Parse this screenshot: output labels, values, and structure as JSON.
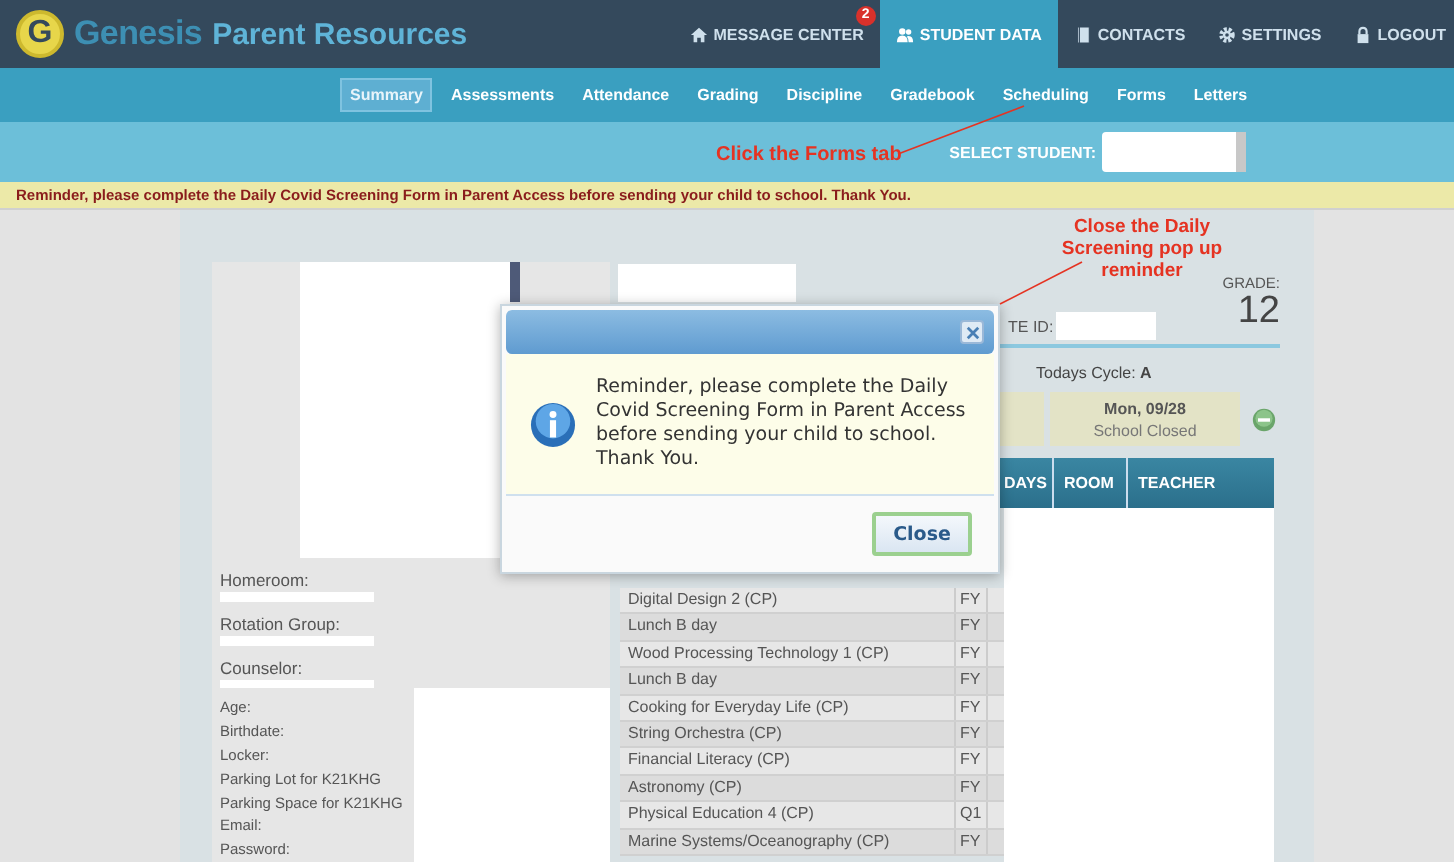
{
  "header": {
    "logo_letter": "G",
    "brand": "Genesis",
    "subtitle": "Parent Resources",
    "nav": [
      {
        "label": "MESSAGE CENTER",
        "badge": "2",
        "selected": false
      },
      {
        "label": "STUDENT DATA",
        "selected": true
      },
      {
        "label": "CONTACTS",
        "selected": false
      },
      {
        "label": "SETTINGS",
        "selected": false
      },
      {
        "label": "LOGOUT",
        "selected": false
      }
    ]
  },
  "tabs": [
    {
      "label": "Summary",
      "selected": true
    },
    {
      "label": "Assessments",
      "selected": false
    },
    {
      "label": "Attendance",
      "selected": false
    },
    {
      "label": "Grading",
      "selected": false
    },
    {
      "label": "Discipline",
      "selected": false
    },
    {
      "label": "Gradebook",
      "selected": false
    },
    {
      "label": "Scheduling",
      "selected": false
    },
    {
      "label": "Forms",
      "selected": false
    },
    {
      "label": "Letters",
      "selected": false
    }
  ],
  "student_select": {
    "label": "SELECT STUDENT:"
  },
  "reminder_banner": "Reminder, please complete the Daily Covid Screening Form in Parent Access before sending your child to school. Thank You.",
  "profile": {
    "fields": [
      "Homeroom:",
      "Rotation Group:",
      "Counselor:"
    ],
    "details": [
      "Age:",
      "Birthdate:",
      "Locker:",
      "Parking Lot for K21KHG",
      "Parking Space for K21KHG",
      "Email:",
      "Password:"
    ]
  },
  "student_info": {
    "state_id_label": "TE ID:",
    "grade_label": "GRADE:",
    "grade": "12",
    "cycle": "Todays Cycle: **A**",
    "day_date": "Mon, 09/28",
    "day_status": "School Closed"
  },
  "schedule": {
    "columns": [
      "DAYS",
      "ROOM",
      "TEACHER"
    ],
    "rows": [
      {
        "course": "Digital Design 2 (CP)",
        "term": "FY"
      },
      {
        "course": "Lunch B day",
        "term": "FY"
      },
      {
        "course": "Wood Processing Technology 1 (CP)",
        "term": "FY"
      },
      {
        "course": "Lunch B day",
        "term": "FY"
      },
      {
        "course": "Cooking for Everyday Life (CP)",
        "term": "FY"
      },
      {
        "course": "String Orchestra (CP)",
        "term": "FY"
      },
      {
        "course": "Financial Literacy (CP)",
        "term": "FY"
      },
      {
        "course": "Astronomy (CP)",
        "term": "FY"
      },
      {
        "course": "Physical Education 4 (CP)",
        "term": "Q1"
      },
      {
        "course": "Marine Systems/Oceanography (CP)",
        "term": "FY"
      }
    ]
  },
  "dialog": {
    "message": "Reminder, please complete the Daily Covid Screening Form in Parent Access before sending your child to school. Thank You.",
    "button": "Close"
  },
  "annotations": [
    "Click the Forms tab",
    "Close the Daily Screening pop up reminder"
  ]
}
